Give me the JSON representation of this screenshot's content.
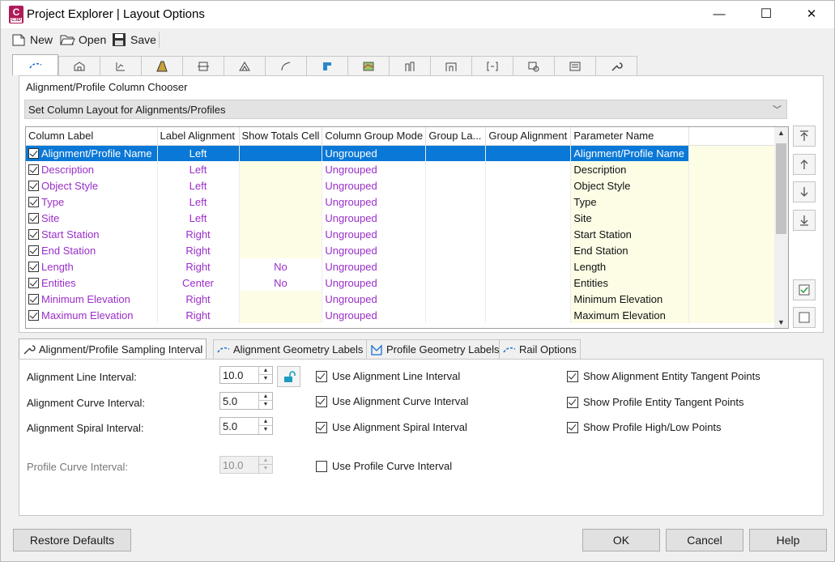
{
  "window": {
    "title": "Project Explorer | Layout Options",
    "app_icon_letter": "C",
    "app_icon_sub": "C3D",
    "minimize_glyph": "—",
    "maximize_glyph": "☐",
    "close_glyph": "✕"
  },
  "toolbar": {
    "new_label": "New",
    "open_label": "Open",
    "save_label": "Save"
  },
  "top_tabs": {
    "icons": [
      "alignment-icon",
      "site-icon",
      "profile-icon",
      "corridor-icon",
      "structure-icon",
      "surface-icon",
      "feature-line-icon",
      "parcel-icon",
      "section-icon",
      "pipe-network-icon",
      "pressure-network-icon",
      "assembly-icon",
      "point-group-icon",
      "catchment-icon",
      "settings-icon"
    ],
    "active_index": 0
  },
  "chooser": {
    "section_label": "Alignment/Profile Column Chooser",
    "layout_value": "Set Column Layout for Alignments/Profiles"
  },
  "grid": {
    "headers": [
      "Column Label",
      "Label Alignment",
      "Show Totals Cell",
      "Column Group Mode",
      "Group La...",
      "Group Alignment",
      "Parameter Name"
    ],
    "rows": [
      {
        "label": "Alignment/Profile Name",
        "align": "Left",
        "totals": "",
        "group_mode": "Ungrouped",
        "param": "Alignment/Profile Name",
        "checked": true
      },
      {
        "label": "Description",
        "align": "Left",
        "totals": "",
        "group_mode": "Ungrouped",
        "param": "Description",
        "checked": true
      },
      {
        "label": "Object Style",
        "align": "Left",
        "totals": "",
        "group_mode": "Ungrouped",
        "param": "Object Style",
        "checked": true
      },
      {
        "label": "Type",
        "align": "Left",
        "totals": "",
        "group_mode": "Ungrouped",
        "param": "Type",
        "checked": true
      },
      {
        "label": "Site",
        "align": "Left",
        "totals": "",
        "group_mode": "Ungrouped",
        "param": "Site",
        "checked": true
      },
      {
        "label": "Start Station",
        "align": "Right",
        "totals": "",
        "group_mode": "Ungrouped",
        "param": "Start Station",
        "checked": true
      },
      {
        "label": "End Station",
        "align": "Right",
        "totals": "",
        "group_mode": "Ungrouped",
        "param": "End Station",
        "checked": true
      },
      {
        "label": "Length",
        "align": "Right",
        "totals": "No",
        "group_mode": "Ungrouped",
        "param": "Length",
        "checked": true
      },
      {
        "label": "Entities",
        "align": "Center",
        "totals": "No",
        "group_mode": "Ungrouped",
        "param": "Entities",
        "checked": true
      },
      {
        "label": "Minimum Elevation",
        "align": "Right",
        "totals": "",
        "group_mode": "Ungrouped",
        "param": "Minimum Elevation",
        "checked": true
      },
      {
        "label": "Maximum Elevation",
        "align": "Right",
        "totals": "",
        "group_mode": "Ungrouped",
        "param": "Maximum Elevation",
        "checked": true
      }
    ],
    "selected_row": 0
  },
  "side_buttons": [
    "move-to-top-icon",
    "move-up-icon",
    "move-down-icon",
    "move-to-bottom-icon",
    "check-all-icon",
    "uncheck-all-icon"
  ],
  "bottom_tabs": [
    {
      "label": "Alignment/Profile Sampling Interval",
      "icon": "wrench-icon"
    },
    {
      "label": "Alignment Geometry Labels",
      "icon": "alignment-icon"
    },
    {
      "label": "Profile Geometry Labels",
      "icon": "profile-icon"
    },
    {
      "label": "Rail Options",
      "icon": "rail-icon"
    }
  ],
  "sampling": {
    "line_label": "Alignment Line Interval:",
    "line_value": "10.0",
    "curve_label": "Alignment Curve Interval:",
    "curve_value": "5.0",
    "spiral_label": "Alignment Spiral Interval:",
    "spiral_value": "5.0",
    "profile_label": "Profile Curve Interval:",
    "profile_value": "10.0",
    "use_line": "Use Alignment Line Interval",
    "use_curve": "Use Alignment Curve Interval",
    "use_spiral": "Use Alignment Spiral Interval",
    "use_profile": "Use Profile Curve Interval",
    "show_align_tangent": "Show Alignment Entity Tangent Points",
    "show_profile_tangent": "Show Profile Entity Tangent Points",
    "show_high_low": "Show Profile High/Low Points"
  },
  "footer": {
    "restore": "Restore Defaults",
    "ok": "OK",
    "cancel": "Cancel",
    "help": "Help"
  }
}
